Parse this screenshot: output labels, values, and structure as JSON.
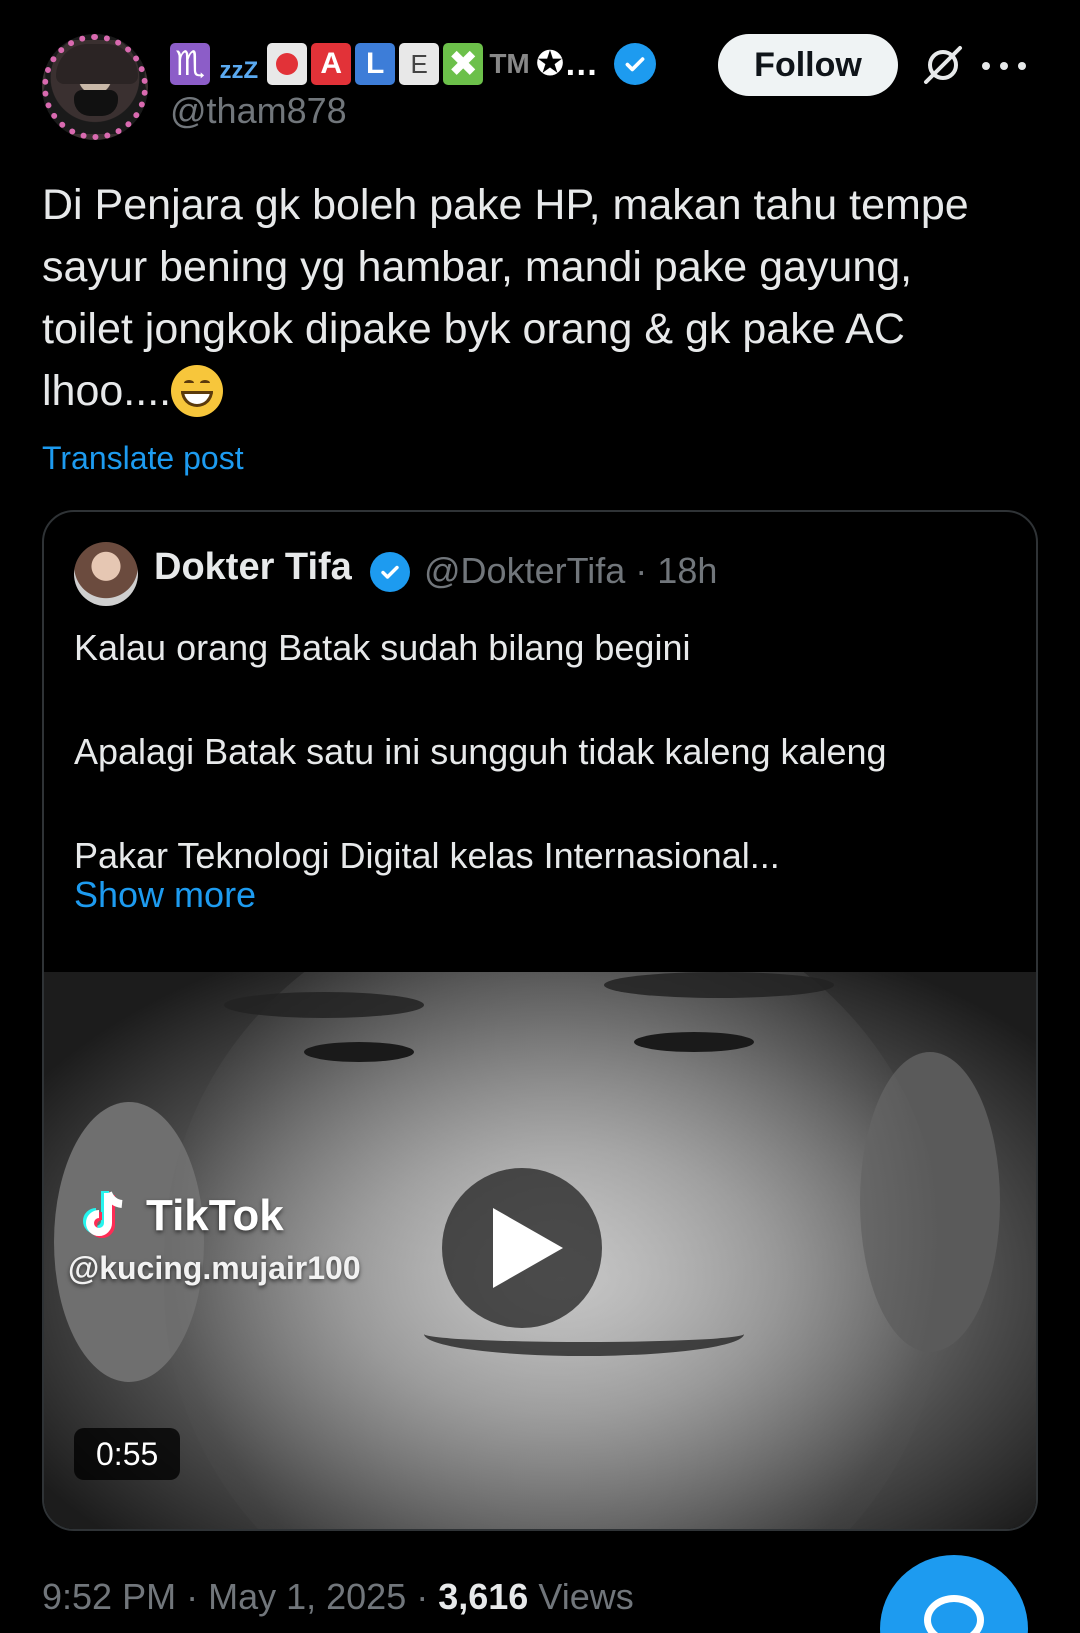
{
  "author": {
    "display_name_emojis": [
      "♏",
      "zzZ",
      "rec",
      "A",
      "L",
      "E",
      "✖",
      "TM",
      "✪…"
    ],
    "handle": "@tham878",
    "follow_label": "Follow"
  },
  "post": {
    "text": "Di Penjara gk boleh pake HP, makan tahu tempe sayur bening yg hambar, mandi pake gayung, toilet jongkok dipake byk orang & gk pake AC lhoo....",
    "translate_label": "Translate post"
  },
  "quote": {
    "name": "Dokter Tifa",
    "handle": "@DokterTifa",
    "separator": "·",
    "age": "18h",
    "paragraphs": [
      "Kalau orang Batak sudah bilang begini",
      "Apalagi Batak satu ini sungguh tidak kaleng kaleng",
      "Pakar Teknologi Digital kelas Internasional..."
    ],
    "show_more_label": "Show more",
    "video": {
      "watermark_brand": "TikTok",
      "watermark_user": "@kucing.mujair100",
      "duration": "0:55"
    }
  },
  "footer": {
    "time": "9:52 PM",
    "date": "May 1, 2025",
    "views_count": "3,616",
    "views_label": "Views"
  },
  "colors": {
    "accent": "#1d9bf0",
    "background": "#000000",
    "text": "#e7e9ea",
    "muted": "#71767b"
  }
}
